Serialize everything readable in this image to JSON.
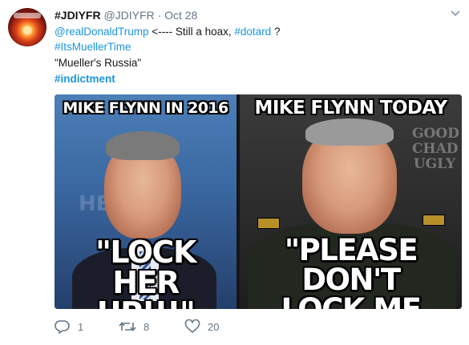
{
  "tweet": {
    "display_name": "#JDIYFR",
    "handle": "@JDIYFR",
    "separator": "·",
    "date": "Oct 28",
    "line1": {
      "mention": "@realDonaldTrump",
      "text": " <---- Still a hoax, ",
      "hashtag": "#dotard",
      "suffix": " ?"
    },
    "line2_hashtag": "#ItsMuellerTime",
    "line3_text": "\"Mueller's Russia\"",
    "line4_hashtag": "#indictment"
  },
  "media": {
    "left_panel": {
      "top_caption": "MIKE FLYNN IN 2016",
      "bottom_caption_line1": "\"LOCK HER",
      "bottom_caption_line2": "UP!!!\"",
      "background_letters": "HE HO"
    },
    "right_panel": {
      "top_caption": "MIKE FLYNN TODAY",
      "bottom_caption_line1": "\"PLEASE DON'T",
      "bottom_caption_line2": "LOCK ME UP!\"",
      "watermark": [
        "GOOD",
        "CHAD",
        "UGLY"
      ]
    }
  },
  "actions": {
    "reply": {
      "icon": "reply-icon",
      "count": "1"
    },
    "retweet": {
      "icon": "retweet-icon",
      "count": "8"
    },
    "like": {
      "icon": "heart-icon",
      "count": "20"
    }
  },
  "colors": {
    "link": "#1b95e0",
    "muted": "#657786",
    "text": "#14171a"
  }
}
